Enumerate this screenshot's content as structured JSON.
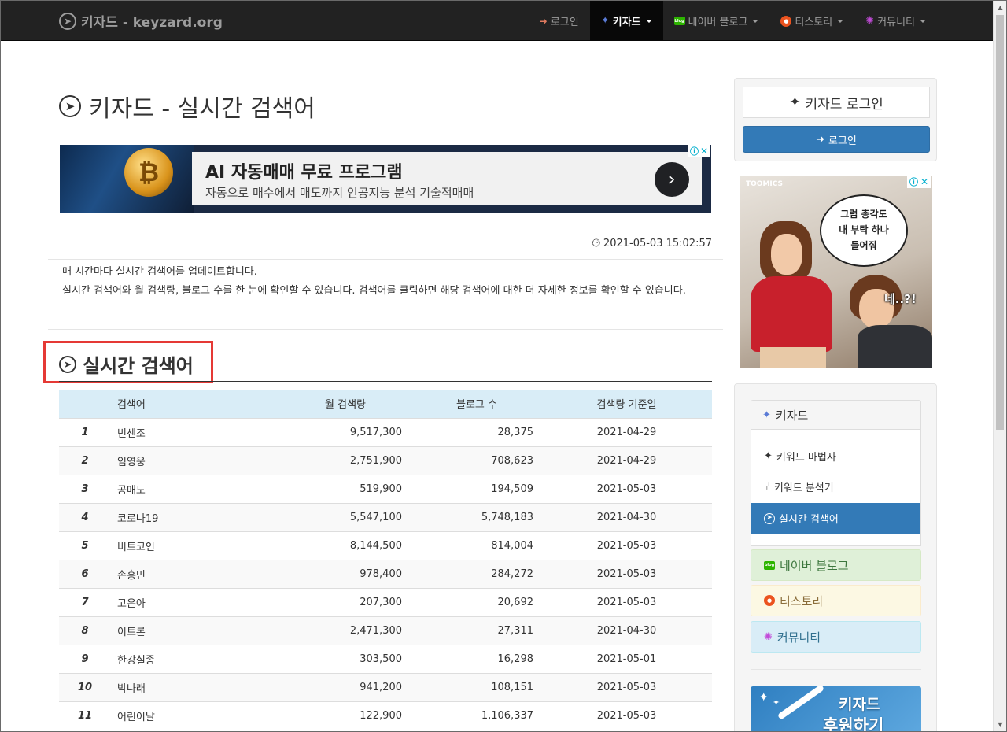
{
  "navbar": {
    "brand": "키자드 - keyzard.org",
    "items": [
      {
        "label": "로그인",
        "icon": "sign-in-icon"
      },
      {
        "label": "키자드",
        "icon": "magic-wand-icon"
      },
      {
        "label": "네이버 블로그",
        "icon": "naver-blog-icon"
      },
      {
        "label": "티스토리",
        "icon": "tistory-icon"
      },
      {
        "label": "커뮤니티",
        "icon": "satellite-icon"
      }
    ]
  },
  "page": {
    "title": "키자드 - 실시간 검색어",
    "timestamp": "2021-05-03 15:02:57",
    "description": [
      "매 시간마다 실시간 검색어를 업데이트합니다.",
      "실시간 검색어와 월 검색량, 블로그 수를 한 눈에 확인할 수 있습니다. 검색어를 클릭하면 해당 검색어에 대한 더 자세한 정보를 확인할 수 있습니다."
    ],
    "section_title": "실시간 검색어"
  },
  "ad_banner": {
    "headline": "AI 자동매매 무료 프로그램",
    "subtext": "자동으로 매수에서 매도까지 인공지능 분석 기술적매매",
    "coin_symbol": "₿",
    "arrow": "›",
    "info": "ⓘ",
    "close": "✕"
  },
  "table": {
    "headers": [
      "검색어",
      "월 검색량",
      "블로그 수",
      "검색량 기준일"
    ],
    "rows": [
      {
        "rank": "1",
        "keyword": "빈센조",
        "monthly": "9,517,300",
        "blogs": "28,375",
        "date": "2021-04-29"
      },
      {
        "rank": "2",
        "keyword": "임영웅",
        "monthly": "2,751,900",
        "blogs": "708,623",
        "date": "2021-04-29"
      },
      {
        "rank": "3",
        "keyword": "공매도",
        "monthly": "519,900",
        "blogs": "194,509",
        "date": "2021-05-03"
      },
      {
        "rank": "4",
        "keyword": "코로나19",
        "monthly": "5,547,100",
        "blogs": "5,748,183",
        "date": "2021-04-30"
      },
      {
        "rank": "5",
        "keyword": "비트코인",
        "monthly": "8,144,500",
        "blogs": "814,004",
        "date": "2021-05-03"
      },
      {
        "rank": "6",
        "keyword": "손흥민",
        "monthly": "978,400",
        "blogs": "284,272",
        "date": "2021-05-03"
      },
      {
        "rank": "7",
        "keyword": "고은아",
        "monthly": "207,300",
        "blogs": "20,692",
        "date": "2021-05-03"
      },
      {
        "rank": "8",
        "keyword": "이트론",
        "monthly": "2,471,300",
        "blogs": "27,311",
        "date": "2021-04-30"
      },
      {
        "rank": "9",
        "keyword": "한강실종",
        "monthly": "303,500",
        "blogs": "16,298",
        "date": "2021-05-01"
      },
      {
        "rank": "10",
        "keyword": "박나래",
        "monthly": "941,200",
        "blogs": "108,151",
        "date": "2021-05-03"
      },
      {
        "rank": "11",
        "keyword": "어린이날",
        "monthly": "122,900",
        "blogs": "1,106,337",
        "date": "2021-05-03"
      }
    ]
  },
  "sidebar": {
    "login_label": "키자드 로그인",
    "login_button": "로그인",
    "side_ad": {
      "brand": "TOOMICS",
      "bubble_lines": [
        "그럼 총각도",
        "내 부탁 하나",
        "들어줘"
      ],
      "boy_text": "네..?!"
    },
    "nav_header": "키자드",
    "nav_items": [
      {
        "label": "키워드 마법사",
        "icon": "magic-wand-icon"
      },
      {
        "label": "키워드 분석기",
        "icon": "code-fork-icon"
      },
      {
        "label": "실시간 검색어",
        "icon": "compass-icon"
      }
    ],
    "naver": "네이버 블로그",
    "tistory": "티스토리",
    "community": "커뮤니티",
    "support": [
      "키자드",
      "후원하기"
    ]
  },
  "colors": {
    "navbar": "#222222",
    "primary": "#337ab7",
    "highlight_box": "#e53935",
    "table_header": "#d9edf7"
  }
}
